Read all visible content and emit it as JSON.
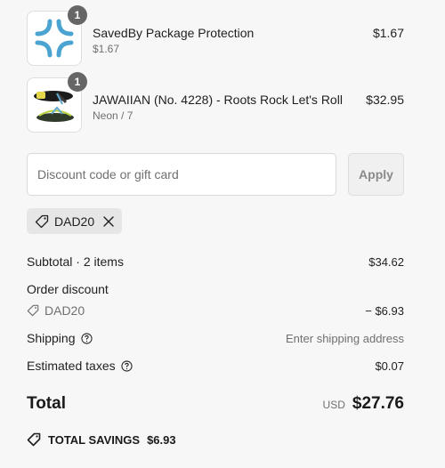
{
  "line_items": [
    {
      "title": "SavedBy Package Protection",
      "subtitle": "$1.67",
      "price": "$1.67",
      "quantity": "1",
      "image": "package-protection-logo"
    },
    {
      "title": "JAWAIIAN (No. 4228) - Roots Rock Let's Roll",
      "subtitle": "Neon / 7",
      "price": "$32.95",
      "quantity": "1",
      "image": "flip-flop-sandal"
    }
  ],
  "discount": {
    "placeholder": "Discount code or gift card",
    "value": "",
    "apply_label": "Apply"
  },
  "applied_code": {
    "code": "DAD20"
  },
  "summary": {
    "subtotal_label": "Subtotal · 2 items",
    "subtotal_value": "$34.62",
    "order_discount_label": "Order discount",
    "discount_code": "DAD20",
    "discount_value": "− $6.93",
    "shipping_label": "Shipping",
    "shipping_value": "Enter shipping address",
    "taxes_label": "Estimated taxes",
    "taxes_value": "$0.07",
    "total_label": "Total",
    "currency": "USD",
    "total_value": "$27.76",
    "savings_label": "TOTAL SAVINGS",
    "savings_value": "$6.93"
  },
  "colors": {
    "background": "#f7f7f7",
    "badge": "#666666",
    "logo_blue": "#4aa3d1"
  }
}
